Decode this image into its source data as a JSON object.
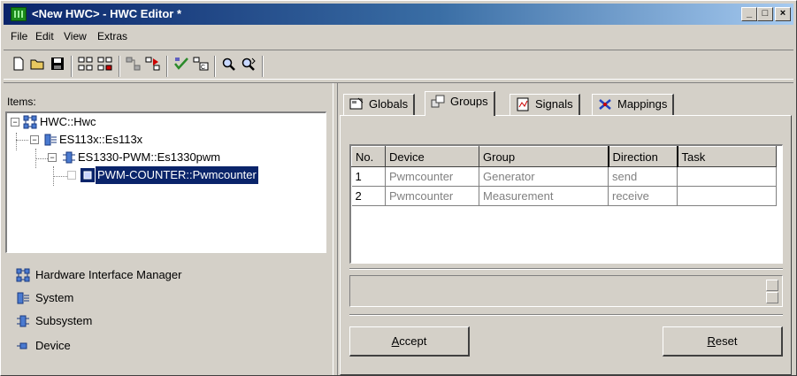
{
  "window": {
    "title": "<New HWC> - HWC Editor  *",
    "controls": [
      "minimize",
      "maximize",
      "close"
    ]
  },
  "menu": {
    "items": [
      "File",
      "Edit",
      "View",
      "Extras"
    ]
  },
  "toolbar": {
    "icons": [
      "new-icon",
      "open-icon",
      "save-icon",
      "add-system-icon",
      "add-subsystem-icon",
      "add-device-icon",
      "export-icon",
      "check-icon",
      "generate-icon",
      "search-icon",
      "search-next-icon"
    ]
  },
  "left": {
    "items_label": "Items:",
    "tree": [
      {
        "label": "HWC::Hwc",
        "type": "manager",
        "expander": "−"
      },
      {
        "label": "ES113x::Es113x",
        "type": "system",
        "expander": "−"
      },
      {
        "label": "ES1330-PWM::Es1330pwm",
        "type": "subsystem",
        "expander": "−"
      },
      {
        "label": "PWM-COUNTER::Pwmcounter",
        "type": "device",
        "expander": "",
        "selected": true
      }
    ],
    "legend": [
      {
        "label": "Hardware Interface Manager",
        "icon": "manager-icon"
      },
      {
        "label": "System",
        "icon": "system-icon"
      },
      {
        "label": "Subsystem",
        "icon": "subsystem-icon"
      },
      {
        "label": "Device",
        "icon": "device-icon"
      }
    ]
  },
  "tabs": [
    {
      "label": "Globals",
      "icon": "globals-icon",
      "active": false
    },
    {
      "label": "Groups",
      "icon": "groups-icon",
      "active": true
    },
    {
      "label": "Signals",
      "icon": "signals-icon",
      "active": false
    },
    {
      "label": "Mappings",
      "icon": "mappings-icon",
      "active": false
    }
  ],
  "groups_table": {
    "columns": [
      "No.",
      "Device",
      "Group",
      "Direction",
      "Task"
    ],
    "rows": [
      [
        "1",
        "Pwmcounter",
        "Generator",
        "send",
        ""
      ],
      [
        "2",
        "Pwmcounter",
        "Measurement",
        "receive",
        ""
      ]
    ]
  },
  "buttons": {
    "accept_label_u": "A",
    "accept_label_rest": "ccept",
    "reset_label_u": "R",
    "reset_label_rest": "eset"
  },
  "colors": {
    "face": "#d4d0c8",
    "title_start": "#0a246a",
    "title_end": "#a6caf0",
    "selection": "#0a246a"
  }
}
